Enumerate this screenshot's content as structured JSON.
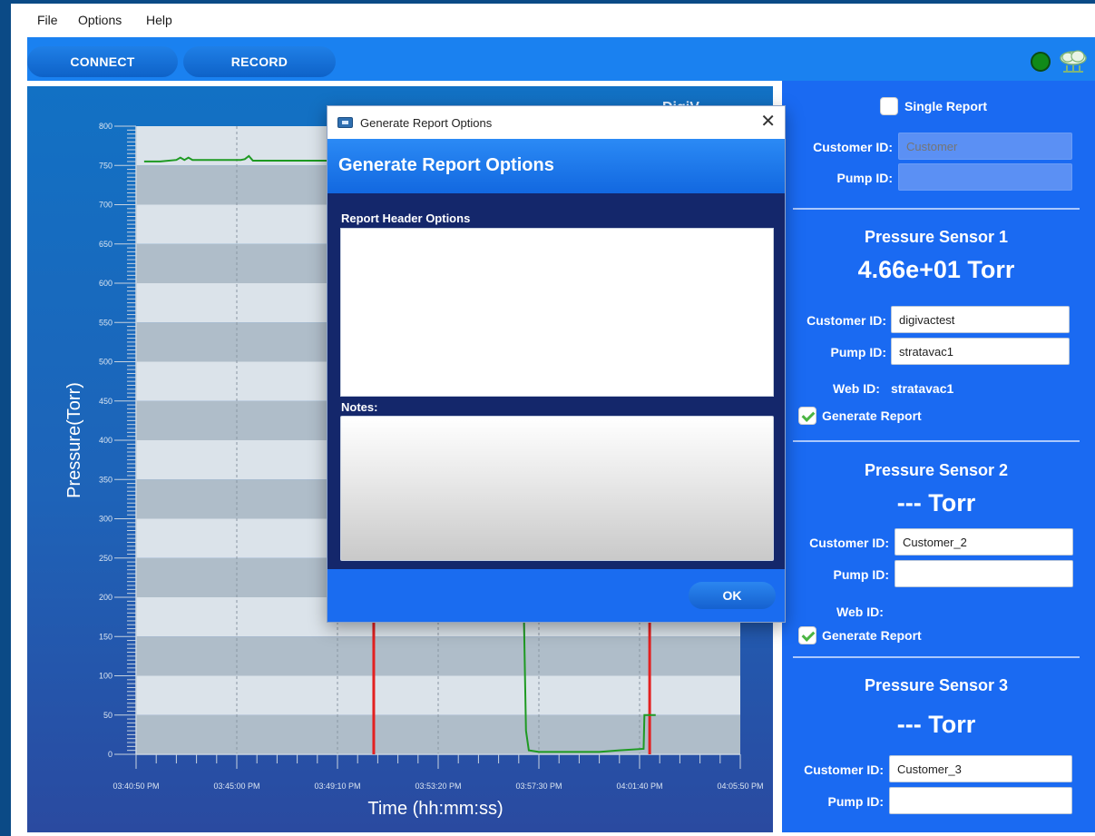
{
  "menu": {
    "file": "File",
    "options": "Options",
    "help": "Help"
  },
  "toolbar": {
    "connect_label": "CONNECT",
    "record_label": "RECORD",
    "status_color": "#108a18",
    "cloud_icon": "cloud-icon"
  },
  "chart": {
    "xlabel": "Time (hh:mm:ss)",
    "ylabel": "Pressure(Torr)",
    "watermark": "DigiV"
  },
  "chart_data": {
    "type": "line",
    "ylim": [
      0,
      800
    ],
    "yticks": [
      0,
      50,
      100,
      150,
      200,
      250,
      300,
      350,
      400,
      450,
      500,
      550,
      600,
      650,
      700,
      750,
      800
    ],
    "xlim": [
      0,
      1500
    ],
    "xticks": [
      0,
      250,
      500,
      750,
      1000,
      1250,
      1500
    ],
    "xtick_labels": [
      "03:40:50 PM",
      "03:45:00 PM",
      "03:49:10 PM",
      "03:53:20 PM",
      "03:57:30 PM",
      "04:01:40 PM",
      "04:05:50 PM"
    ],
    "grid": true,
    "markers": [
      {
        "x": 590,
        "color": "#e32020"
      },
      {
        "x": 1275,
        "color": "#e32020"
      }
    ],
    "series": [
      {
        "color": "#1e9a22",
        "x": [
          20,
          60,
          100,
          110,
          120,
          130,
          140,
          200,
          260,
          270,
          280,
          290,
          340,
          470,
          940,
          962,
          968,
          975,
          1000,
          1100,
          1150,
          1200,
          1260,
          1262,
          1290
        ],
        "y": [
          755,
          755,
          757,
          760,
          757,
          760,
          757,
          757,
          757,
          758,
          762,
          756,
          756,
          756,
          756,
          200,
          30,
          5,
          3,
          3,
          3,
          5,
          7,
          50,
          50
        ]
      }
    ]
  },
  "side": {
    "single_report_label": "Single Report",
    "customer_id_label": "Customer ID:",
    "pump_id_label": "Pump ID:",
    "customer_placeholder": "Customer",
    "web_id_label": "Web ID:",
    "generate_report_label": "Generate Report",
    "sensors": [
      {
        "title": "Pressure Sensor 1",
        "reading": "4.66e+01 Torr",
        "customer_id": "digivactest",
        "pump_id": "stratavac1",
        "web_id": "stratavac1",
        "generate": true
      },
      {
        "title": "Pressure Sensor 2",
        "reading": "--- Torr",
        "customer_id": "Customer_2",
        "pump_id": "",
        "web_id": "",
        "generate": true
      },
      {
        "title": "Pressure Sensor 3",
        "reading": "--- Torr",
        "customer_id": "Customer_3",
        "pump_id": ""
      }
    ]
  },
  "dialog": {
    "window_title": "Generate Report Options",
    "header": "Generate Report Options",
    "report_header_label": "Report Header Options",
    "notes_label": "Notes:",
    "ok_label": "OK",
    "close_glyph": "✕"
  }
}
